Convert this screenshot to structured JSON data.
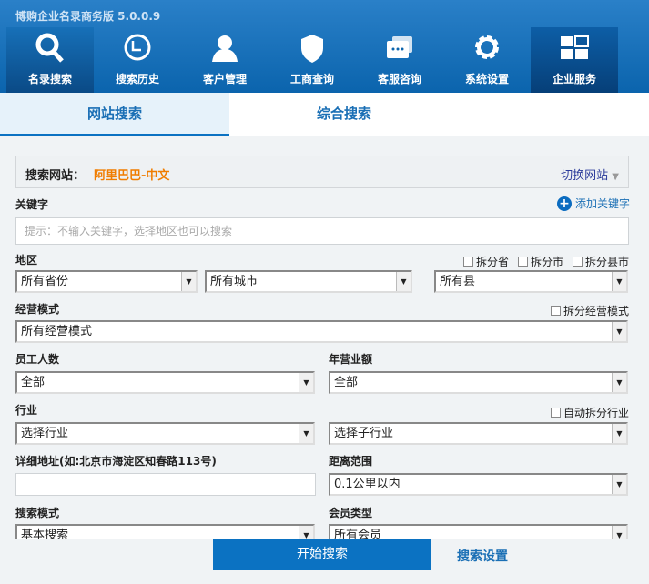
{
  "app": {
    "title": "博购企业名录商务版 5.0.0.9"
  },
  "nav": [
    {
      "label": "名录搜索",
      "icon": "search-icon"
    },
    {
      "label": "搜索历史",
      "icon": "clock-icon"
    },
    {
      "label": "客户管理",
      "icon": "user-icon"
    },
    {
      "label": "工商查询",
      "icon": "shield-icon"
    },
    {
      "label": "客服咨询",
      "icon": "chat-icon"
    },
    {
      "label": "系统设置",
      "icon": "gear-icon"
    },
    {
      "label": "企业服务",
      "icon": "grid-icon"
    }
  ],
  "tabs": [
    {
      "label": "网站搜索",
      "active": true
    },
    {
      "label": "综合搜索",
      "active": false
    }
  ],
  "site": {
    "label": "搜索网站：",
    "value": "阿里巴巴-中文",
    "switch": "切换网站"
  },
  "keyword": {
    "label": "关键字",
    "add": "添加关键字",
    "placeholder": "提示：不输入关键字，选择地区也可以搜索"
  },
  "region": {
    "label": "地区",
    "checks": [
      "拆分省",
      "拆分市",
      "拆分县市"
    ],
    "province": "所有省份",
    "city": "所有城市",
    "county": "所有县"
  },
  "mode": {
    "label": "经营模式",
    "check": "拆分经营模式",
    "value": "所有经营模式"
  },
  "staff": {
    "label": "员工人数",
    "value": "全部"
  },
  "revenue": {
    "label": "年营业额",
    "value": "全部"
  },
  "industry": {
    "label": "行业",
    "check": "自动拆分行业",
    "value": "选择行业",
    "sub": "选择子行业"
  },
  "address": {
    "label": "详细地址(如:北京市海淀区知春路113号)",
    "value": ""
  },
  "distance": {
    "label": "距离范围",
    "value": "0.1公里以内"
  },
  "search_mode": {
    "label": "搜索模式",
    "value": "基本搜索"
  },
  "member": {
    "label": "会员类型",
    "value": "所有会员"
  },
  "actions": {
    "start": "开始搜索",
    "settings": "搜索设置"
  },
  "colors": {
    "header": "#0b64ad",
    "accent": "#0b72c2",
    "site_value": "#f07d00"
  }
}
